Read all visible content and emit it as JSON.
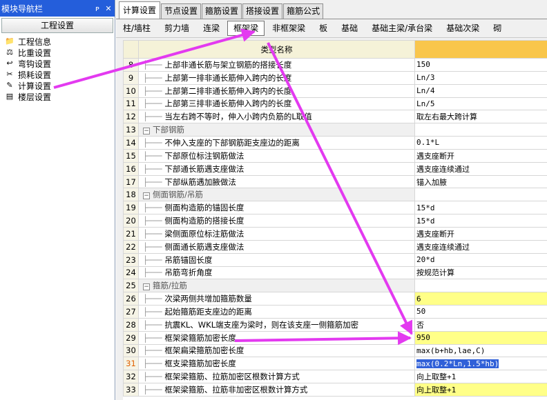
{
  "nav": {
    "title": "模块导航栏",
    "pin": "ᴘ",
    "close": "✕",
    "section": "工程设置",
    "items": [
      {
        "label": "工程信息"
      },
      {
        "label": "比重设置"
      },
      {
        "label": "弯钩设置"
      },
      {
        "label": "损耗设置"
      },
      {
        "label": "计算设置"
      },
      {
        "label": "楼层设置"
      }
    ]
  },
  "tabs": [
    "计算设置",
    "节点设置",
    "箍筋设置",
    "搭接设置",
    "箍筋公式"
  ],
  "active_tab": 0,
  "subtabs": [
    "柱/墙柱",
    "剪力墙",
    "连梁",
    "框架梁",
    "非框架梁",
    "板",
    "基础",
    "基础主梁/承台梁",
    "基础次梁",
    "砌"
  ],
  "active_subtab": 3,
  "grid": {
    "header_name": "类型名称",
    "rows": [
      {
        "n": "8",
        "name": "上部非通长筋与架立钢筋的搭接长度",
        "value": "150"
      },
      {
        "n": "9",
        "name": "上部第一排非通长筋伸入跨内的长度",
        "value": "Ln/3"
      },
      {
        "n": "10",
        "name": "上部第二排非通长筋伸入跨内的长度",
        "value": "Ln/4"
      },
      {
        "n": "11",
        "name": "上部第三排非通长筋伸入跨内的长度",
        "value": "Ln/5"
      },
      {
        "n": "12",
        "name": "当左右跨不等时，伸入小跨内负筋的L取值",
        "value": "取左右最大跨计算"
      },
      {
        "n": "13",
        "group": true,
        "name": "下部钢筋",
        "value": ""
      },
      {
        "n": "14",
        "name": "不伸入支座的下部钢筋距支座边的距离",
        "value": "0.1*L"
      },
      {
        "n": "15",
        "name": "下部原位标注钢筋做法",
        "value": "遇支座断开"
      },
      {
        "n": "16",
        "name": "下部通长筋遇支座做法",
        "value": "遇支座连续通过"
      },
      {
        "n": "17",
        "name": "下部纵筋遇加腋做法",
        "value": "锚入加腋"
      },
      {
        "n": "18",
        "group": true,
        "name": "侧面钢筋/吊筋",
        "value": ""
      },
      {
        "n": "19",
        "name": "侧面构造筋的锚固长度",
        "value": "15*d"
      },
      {
        "n": "20",
        "name": "侧面构造筋的搭接长度",
        "value": "15*d"
      },
      {
        "n": "21",
        "name": "梁侧面原位标注筋做法",
        "value": "遇支座断开"
      },
      {
        "n": "22",
        "name": "侧面通长筋遇支座做法",
        "value": "遇支座连续通过"
      },
      {
        "n": "23",
        "name": "吊筋锚固长度",
        "value": "20*d"
      },
      {
        "n": "24",
        "name": "吊筋弯折角度",
        "value": "按规范计算"
      },
      {
        "n": "25",
        "group": true,
        "name": "箍筋/拉筋",
        "value": ""
      },
      {
        "n": "26",
        "name": "次梁两侧共增加箍筋数量",
        "value": "6",
        "hl": true
      },
      {
        "n": "27",
        "name": "起始箍筋距支座边的距离",
        "value": "50"
      },
      {
        "n": "28",
        "name": "抗震KL、WKL端支座为梁时，则在该支座一侧箍筋加密",
        "value": "否"
      },
      {
        "n": "29",
        "name": "框架梁箍筋加密长度",
        "value": "950",
        "hl": true
      },
      {
        "n": "30",
        "name": "框架扁梁箍筋加密长度",
        "value": "max(b+hb,lae,C)"
      },
      {
        "n": "31",
        "name": "框支梁箍筋加密长度",
        "value": "max(0.2*Ln,1.5*hb)",
        "selected": true
      },
      {
        "n": "32",
        "name": "框架梁箍筋、拉筋加密区根数计算方式",
        "value": "向上取整+1"
      },
      {
        "n": "33",
        "name": "框架梁箍筋、拉筋非加密区根数计算方式",
        "value": "向上取整+1",
        "hl": true
      }
    ]
  }
}
